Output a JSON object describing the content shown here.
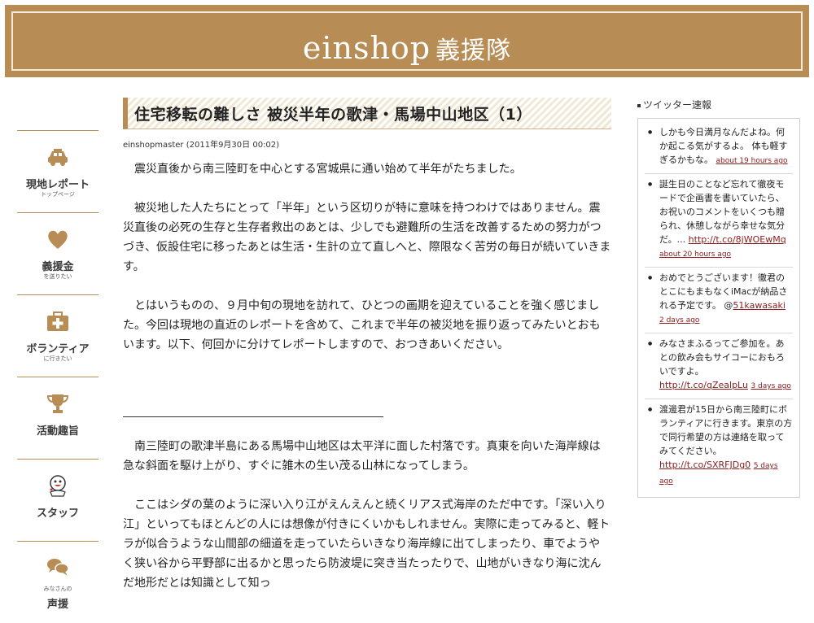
{
  "header": {
    "title_latin": "einshop",
    "title_jp": "義援隊"
  },
  "nav": [
    {
      "label": "現地レポート",
      "sub": "トップページ",
      "icon": "car-icon"
    },
    {
      "label": "義援金",
      "sub": "を送りたい",
      "icon": "heart-icon"
    },
    {
      "label": "ボランティア",
      "sub": "に行きたい",
      "icon": "first-aid-icon"
    },
    {
      "label": "活動趣旨",
      "sub": "",
      "icon": "trophy-icon"
    },
    {
      "label": "スタッフ",
      "sub": "",
      "icon": "mascot-icon"
    },
    {
      "label": "声援",
      "sub": "みなさんの",
      "icon": "chat-bubbles-icon"
    }
  ],
  "article": {
    "title": "住宅移転の難しさ 被災半年の歌津・馬場中山地区（1）",
    "meta": "einshopmaster (2011年9月30日 00:02)",
    "paragraphs_before": [
      "震災直後から南三陸町を中心とする宮城県に通い始めて半年がたちました。",
      "被災地した人たちにとって「半年」という区切りが特に意味を持つわけではありません。震災直後の必死の生存と生存者救出のあとは、少しでも避難所の生活を改善するための努力がつづき、仮設住宅に移ったあとは生活・生計の立て直しへと、際限なく苦労の毎日が続いていきます。",
      "とはいうものの、９月中旬の現地を訪れて、ひとつの画期を迎えていることを強く感じました。今回は現地の直近のレポートを含めて、これまで半年の被災地を振り返ってみたいとおもいます。以下、何回かに分けてレポートしますので、おつきあいください。"
    ],
    "paragraphs_after": [
      "南三陸町の歌津半島にある馬場中山地区は太平洋に面した村落です。真東を向いた海岸線は急な斜面を駆け上がり、すぐに雑木の生い茂る山林になってしまう。",
      "ここはシダの葉のように深い入り江がえんえんと続くリアス式海岸のただ中です。「深い入り江」といってもほとんどの人には想像が付きにくいかもしれません。実際に走ってみると、軽トラが似合うような山間部の細道を走っていたらいきなり海岸線に出てしまったり、車でようやく狭い谷から平野部に出るかと思ったら防波堤に突き当たったりで、山地がいきなり海に沈んだ地形だとは知識として知っ"
    ]
  },
  "sidebar": {
    "heading": "ツイッター速報",
    "tweets": [
      {
        "text": "しかも今日満月なんだよね。何か起こる気がするよ。 体も軽すぎるかもな。",
        "link": "",
        "time": "about 19 hours ago"
      },
      {
        "text": "誕生日のことなど忘れて徹夜モードで企画書を書いていたら、お祝いのコメントをいくつも贈られ、休憩しながら幸せな気分だ。...",
        "link": "http://t.co/8jWOEwMq",
        "time": "about 20 hours ago"
      },
      {
        "text": "おめでとうございます！徹君のとこにもまもなくiMacが納品される予定です。 @",
        "link": "51kawasaki",
        "time": "2 days ago"
      },
      {
        "text": "みなさまふるってご参加を。あとの飲み会もサイコーにおもろいですよ。",
        "link": "http://t.co/qZealpLu",
        "time": "3 days ago"
      },
      {
        "text": "渡邊君が15日から南三陸町にボランティアに行きます。東京の方で同行希望の方は連絡を取ってみてください。",
        "link": "http://t.co/SXRFJDg0",
        "time": "5 days ago"
      }
    ]
  },
  "colors": {
    "brand": "#b88c55",
    "link": "#8a1c1c"
  }
}
